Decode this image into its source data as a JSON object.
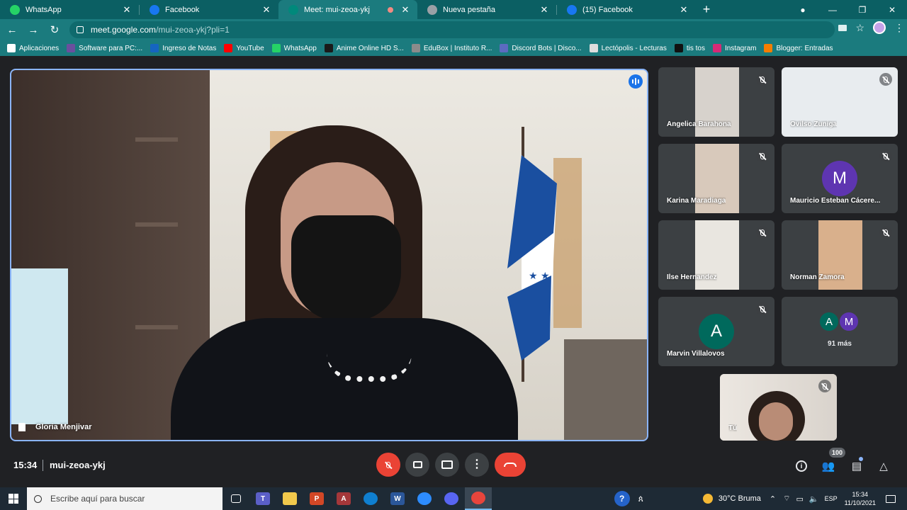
{
  "browser": {
    "tabs": [
      {
        "title": "WhatsApp",
        "icon": "whatsapp-icon",
        "color": "#25d366",
        "active": false
      },
      {
        "title": "Facebook",
        "icon": "facebook-icon",
        "color": "#1877f2",
        "active": false
      },
      {
        "title": "Meet: mui-zeoa-ykj",
        "icon": "meet-icon",
        "color": "#00897b",
        "active": true,
        "recording": true
      },
      {
        "title": "Nueva pestaña",
        "icon": "chrome-icon",
        "color": "#9aa0a6",
        "active": false
      },
      {
        "title": "(15) Facebook",
        "icon": "facebook-icon",
        "color": "#1877f2",
        "active": false
      }
    ],
    "url_host": "meet.google.com",
    "url_path": "/mui-zeoa-ykj?pli=1",
    "bookmarks": [
      {
        "label": "Aplicaciones",
        "icon": "apps-grid-icon",
        "color": "#ffffff"
      },
      {
        "label": "Software para PC:...",
        "icon": "software-icon",
        "color": "#6b4f9e"
      },
      {
        "label": "Ingreso de Notas",
        "icon": "flag-icon",
        "color": "#1565c0"
      },
      {
        "label": "YouTube",
        "icon": "youtube-icon",
        "color": "#ff0000"
      },
      {
        "label": "WhatsApp",
        "icon": "whatsapp-icon",
        "color": "#25d366"
      },
      {
        "label": "Anime Online HD S...",
        "icon": "anime-icon",
        "color": "#1a1a1a"
      },
      {
        "label": "EduBox | Instituto R...",
        "icon": "edubox-icon",
        "color": "#8b8b8b"
      },
      {
        "label": "Discord Bots | Disco...",
        "icon": "discord-bots-icon",
        "color": "#5c6bc0"
      },
      {
        "label": "Lectópolis - Lecturas",
        "icon": "globe-icon",
        "color": "#dddddd"
      },
      {
        "label": "tis tos",
        "icon": "tiktok-icon",
        "color": "#111111"
      },
      {
        "label": "Instagram",
        "icon": "instagram-icon",
        "color": "#d62976"
      },
      {
        "label": "Blogger: Entradas",
        "icon": "blogger-icon",
        "color": "#f57d00"
      }
    ]
  },
  "meet": {
    "main_speaker": "Gloria Menjivar",
    "participants": [
      {
        "name": "Angelica Barahona",
        "type": "video",
        "bg": "#d7d2cc"
      },
      {
        "name": "Ovilso Zuniga",
        "type": "video",
        "bg": "#e8ecef"
      },
      {
        "name": "Karina Maradiaga",
        "type": "video",
        "bg": "#d8c9bb"
      },
      {
        "name": "Mauricio Esteban Cácere...",
        "type": "avatar",
        "initial": "M",
        "avatar_color": "#5e35b1"
      },
      {
        "name": "Ilse Hernandez",
        "type": "video",
        "bg": "#e9e6e0"
      },
      {
        "name": "Norman Zamora",
        "type": "video",
        "bg": "#d9b08c"
      },
      {
        "name": "Marvin Villalovos",
        "type": "avatar",
        "initial": "A",
        "avatar_color": "#00695c"
      }
    ],
    "more": {
      "initials": [
        "A",
        "M"
      ],
      "colors": [
        "#00695c",
        "#5e35b1"
      ],
      "label": "91 más"
    },
    "self_label": "Tú",
    "time": "15:34",
    "code": "mui-zeoa-ykj",
    "people_count": "100"
  },
  "taskbar": {
    "search_placeholder": "Escribe aquí para buscar",
    "apps": [
      {
        "name": "task-view-icon",
        "label": "",
        "color": "transparent"
      },
      {
        "name": "teams-icon",
        "label": "T",
        "color": "#5b5fc7"
      },
      {
        "name": "file-explorer-icon",
        "label": "",
        "color": "#f2c94c"
      },
      {
        "name": "powerpoint-icon",
        "label": "P",
        "color": "#d24726"
      },
      {
        "name": "access-icon",
        "label": "A",
        "color": "#a4373a"
      },
      {
        "name": "edge-icon",
        "label": "",
        "color": "#0f7fd0"
      },
      {
        "name": "word-icon",
        "label": "W",
        "color": "#2b579a"
      },
      {
        "name": "zoom-icon",
        "label": "",
        "color": "#2d8cff"
      },
      {
        "name": "discord-icon",
        "label": "",
        "color": "#5865f2"
      },
      {
        "name": "chrome-icon",
        "label": "",
        "color": "#e8453c",
        "active": true
      }
    ],
    "weather": "30°C  Bruma",
    "lang": "ESP",
    "time": "15:34",
    "date": "11/10/2021"
  }
}
